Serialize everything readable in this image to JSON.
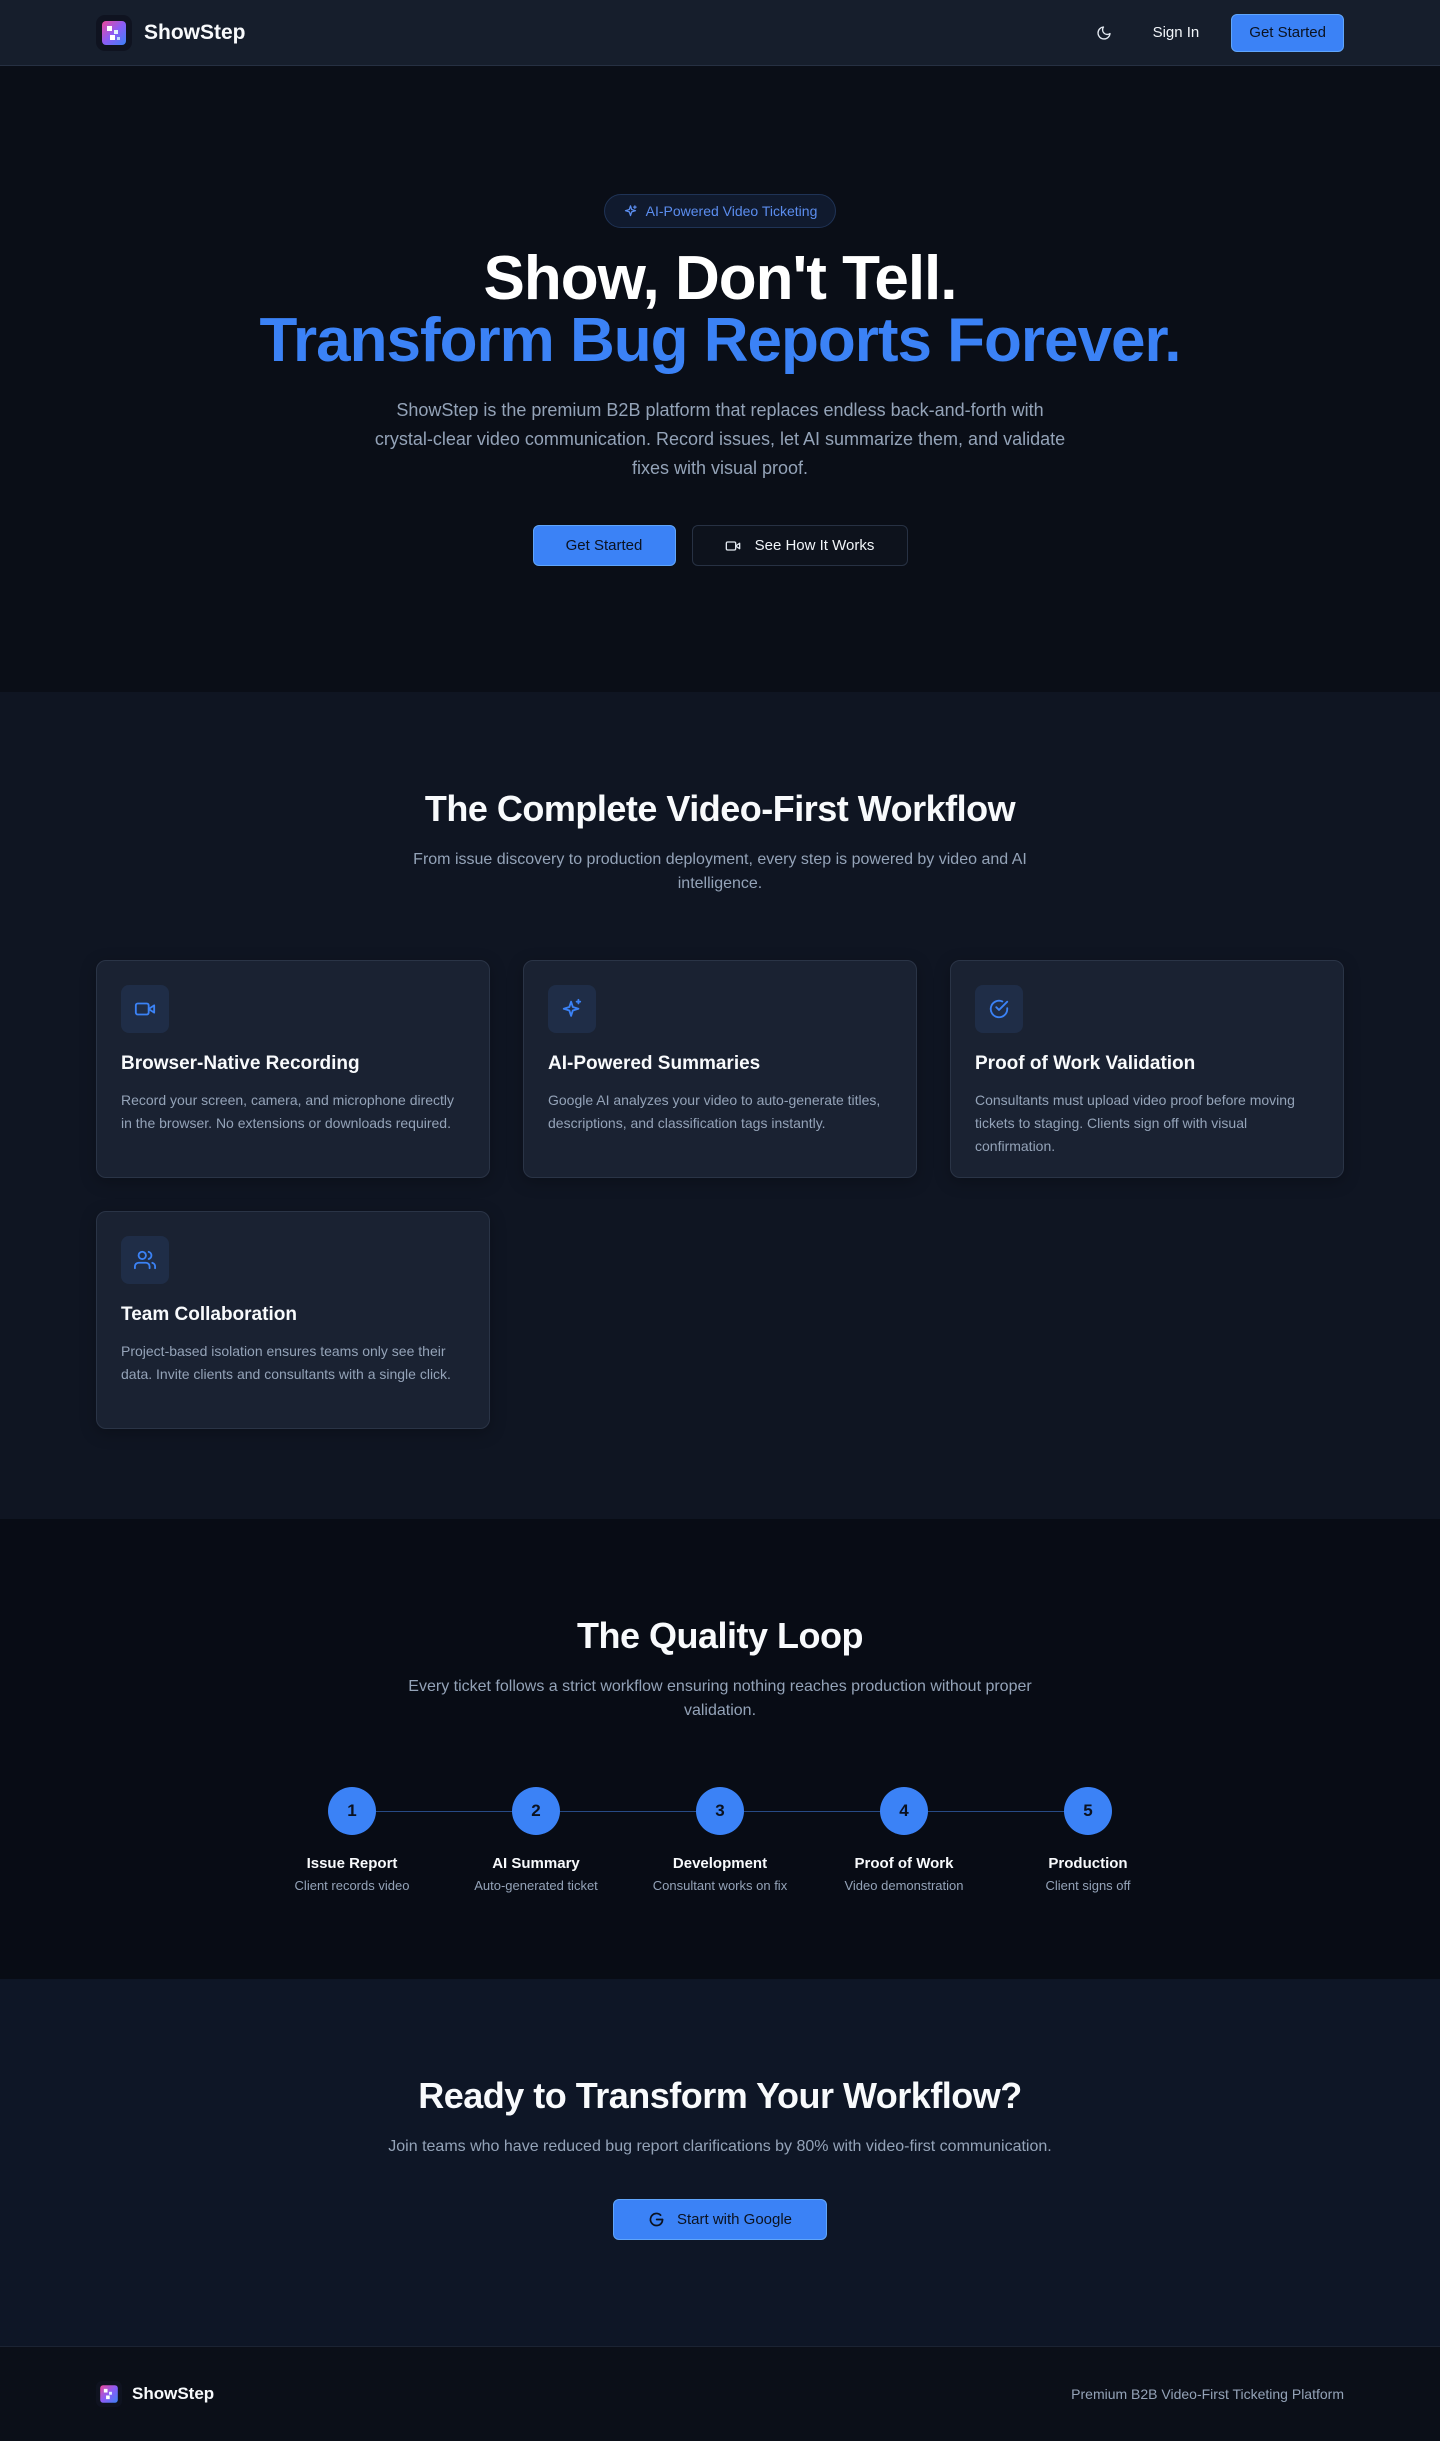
{
  "nav": {
    "brand": "ShowStep",
    "sign_in": "Sign In",
    "get_started": "Get Started"
  },
  "hero": {
    "badge": "AI-Powered Video Ticketing",
    "title_line1": "Show, Don't Tell.",
    "title_line2": "Transform Bug Reports Forever.",
    "subtitle": "ShowStep is the premium B2B platform that replaces endless back-and-forth with crystal-clear video communication. Record issues, let AI summarize them, and validate fixes with visual proof.",
    "cta_primary": "Get Started",
    "cta_secondary": "See How It Works"
  },
  "features": {
    "title": "The Complete Video-First Workflow",
    "subtitle": "From issue discovery to production deployment, every step is powered by video and AI intelligence.",
    "cards": [
      {
        "icon": "video-icon",
        "title": "Browser-Native Recording",
        "desc": "Record your screen, camera, and microphone directly in the browser. No extensions or downloads required."
      },
      {
        "icon": "sparkles-icon",
        "title": "AI-Powered Summaries",
        "desc": "Google AI analyzes your video to auto-generate titles, descriptions, and classification tags instantly."
      },
      {
        "icon": "check-circle-icon",
        "title": "Proof of Work Validation",
        "desc": "Consultants must upload video proof before moving tickets to staging. Clients sign off with visual confirmation."
      },
      {
        "icon": "users-icon",
        "title": "Team Collaboration",
        "desc": "Project-based isolation ensures teams only see their data. Invite clients and consultants with a single click."
      }
    ]
  },
  "loop": {
    "title": "The Quality Loop",
    "subtitle": "Every ticket follows a strict workflow ensuring nothing reaches production without proper validation.",
    "steps": [
      {
        "num": "1",
        "title": "Issue Report",
        "desc": "Client records video"
      },
      {
        "num": "2",
        "title": "AI Summary",
        "desc": "Auto-generated ticket"
      },
      {
        "num": "3",
        "title": "Development",
        "desc": "Consultant works on fix"
      },
      {
        "num": "4",
        "title": "Proof of Work",
        "desc": "Video demonstration"
      },
      {
        "num": "5",
        "title": "Production",
        "desc": "Client signs off"
      }
    ]
  },
  "cta": {
    "title": "Ready to Transform Your Workflow?",
    "subtitle": "Join teams who have reduced bug report clarifications by 80% with video-first communication.",
    "button": "Start with Google"
  },
  "footer": {
    "brand": "ShowStep",
    "tagline": "Premium B2B Video-First Ticketing Platform"
  },
  "colors": {
    "accent": "#3b82f6",
    "background": "#0a0e17",
    "card": "#1a2232"
  }
}
